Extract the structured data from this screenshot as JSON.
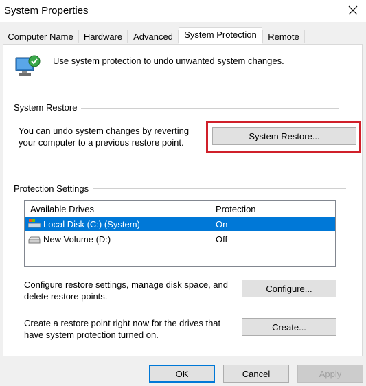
{
  "window": {
    "title": "System Properties"
  },
  "tabs": [
    {
      "label": "Computer Name"
    },
    {
      "label": "Hardware"
    },
    {
      "label": "Advanced"
    },
    {
      "label": "System Protection"
    },
    {
      "label": "Remote"
    }
  ],
  "active_tab": "System Protection",
  "intro": {
    "text": "Use system protection to undo unwanted system changes."
  },
  "system_restore": {
    "group_label": "System Restore",
    "description_line1": "You can undo system changes by reverting",
    "description_line2": "your computer to a previous restore point.",
    "button_label": "System Restore..."
  },
  "protection": {
    "group_label": "Protection Settings",
    "columns": [
      "Available Drives",
      "Protection"
    ],
    "rows": [
      {
        "drive": "Local Disk (C:) (System)",
        "protection": "On",
        "selected": true,
        "icon": "system-drive-icon"
      },
      {
        "drive": "New Volume (D:)",
        "protection": "Off",
        "selected": false,
        "icon": "drive-icon"
      }
    ],
    "configure_text_line1": "Configure restore settings, manage disk space, and",
    "configure_text_line2": "delete restore points.",
    "configure_button": "Configure...",
    "create_text_line1": "Create a restore point right now for the drives that",
    "create_text_line2": "have system protection turned on.",
    "create_button": "Create..."
  },
  "footer": {
    "ok": "OK",
    "cancel": "Cancel",
    "apply": "Apply"
  },
  "colors": {
    "accent": "#0078d7",
    "highlight": "#d0202a"
  }
}
